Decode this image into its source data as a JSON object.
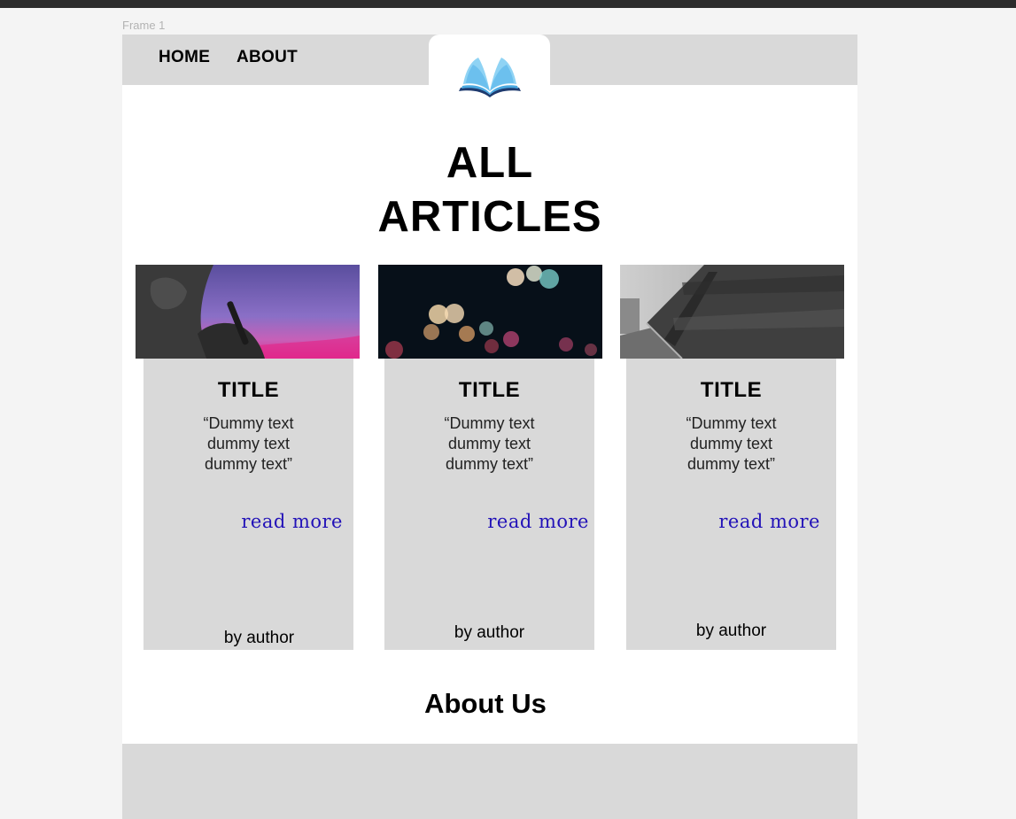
{
  "canvas": {
    "frame_label": "Frame 1"
  },
  "nav": {
    "home": "HOME",
    "about": "ABOUT"
  },
  "logo": {
    "icon": "open-book-icon",
    "colors": [
      "#8fd3f4",
      "#4aa8e0",
      "#1e3a6e"
    ]
  },
  "page": {
    "title_line1": "ALL",
    "title_line2": "ARTICLES"
  },
  "cards": [
    {
      "title": "TITLE",
      "text_line1": "“Dummy text",
      "text_line2": "dummy text",
      "text_line3": "dummy text”",
      "read_more": "read more",
      "author": "by author",
      "image": "hand-holding-pen-purple-sky"
    },
    {
      "title": "TITLE",
      "text_line1": "“Dummy text",
      "text_line2": "dummy text",
      "text_line3": "dummy text”",
      "read_more": "read more",
      "author": "by author",
      "image": "bokeh-lights-night"
    },
    {
      "title": "TITLE",
      "text_line1": "“Dummy text",
      "text_line2": "dummy text",
      "text_line3": "dummy text”",
      "read_more": "read more",
      "author": "by author",
      "image": "stone-wall-walkway-bw"
    }
  ],
  "about": {
    "heading": "About Us"
  },
  "colors": {
    "nav_bg": "#d9d9d9",
    "card_bg": "#d9d9d9",
    "link": "#2212b8",
    "canvas_bg": "#f4f4f4"
  }
}
